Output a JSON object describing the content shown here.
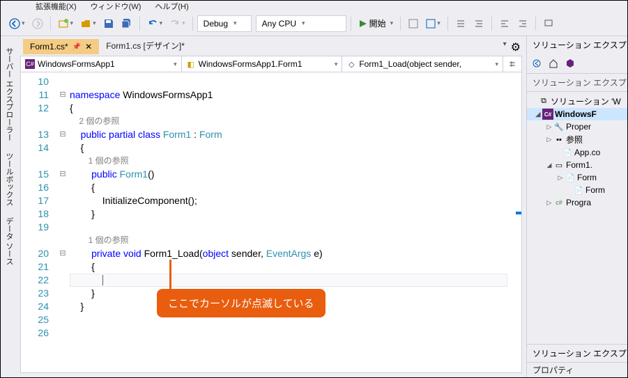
{
  "menu": {
    "items": [
      "拡張機能(X)",
      "ウィンドウ(W)",
      "ヘルプ(H)"
    ]
  },
  "toolbar": {
    "config": "Debug",
    "platform": "Any CPU",
    "start": "開始"
  },
  "sidebar_tabs": [
    "サーバー エクスプローラー",
    "ツールボックス",
    "データ ソース"
  ],
  "tabs": [
    {
      "label": "Form1.cs*",
      "active": true,
      "pinned": true
    },
    {
      "label": "Form1.cs [デザイン]*",
      "active": false
    }
  ],
  "nav": {
    "project": "WindowsFormsApp1",
    "class": "WindowsFormsApp1.Form1",
    "member": "Form1_Load(object sender,"
  },
  "code": {
    "lines": [
      "10",
      "11",
      "12",
      "",
      "13",
      "14",
      "",
      "15",
      "16",
      "17",
      "18",
      "19",
      "",
      "20",
      "21",
      "22",
      "23",
      "24",
      "25",
      "26"
    ],
    "namespace_kw": "namespace",
    "namespace": "WindowsFormsApp1",
    "ref2": "2 個の参照",
    "pub_partial": "public partial class",
    "form1": "Form1",
    "colon_form": " : ",
    "form": "Form",
    "ref1a": "1 個の参照",
    "pub": "public",
    "ctor": "Form1",
    "init": "InitializeComponent();",
    "ref1b": "1 個の参照",
    "priv_void": "private void",
    "method": "Form1_Load",
    "params_obj": "object",
    "params_sender": " sender, ",
    "params_ea": "EventArgs",
    "params_e": " e)"
  },
  "callout": "ここでカーソルが点滅している",
  "solution": {
    "title": "ソリューション エクスプ",
    "search": "ソリューション エクスプ",
    "root": "ソリューション 'W",
    "project": "WindowsF",
    "props": "Proper",
    "refs": "参照",
    "appco": "App.co",
    "form1": "Form1.",
    "form1c": "Form",
    "form1d": "Form",
    "program": "Progra",
    "footer": "ソリューション エクスプ",
    "prop": "プロパティ"
  }
}
